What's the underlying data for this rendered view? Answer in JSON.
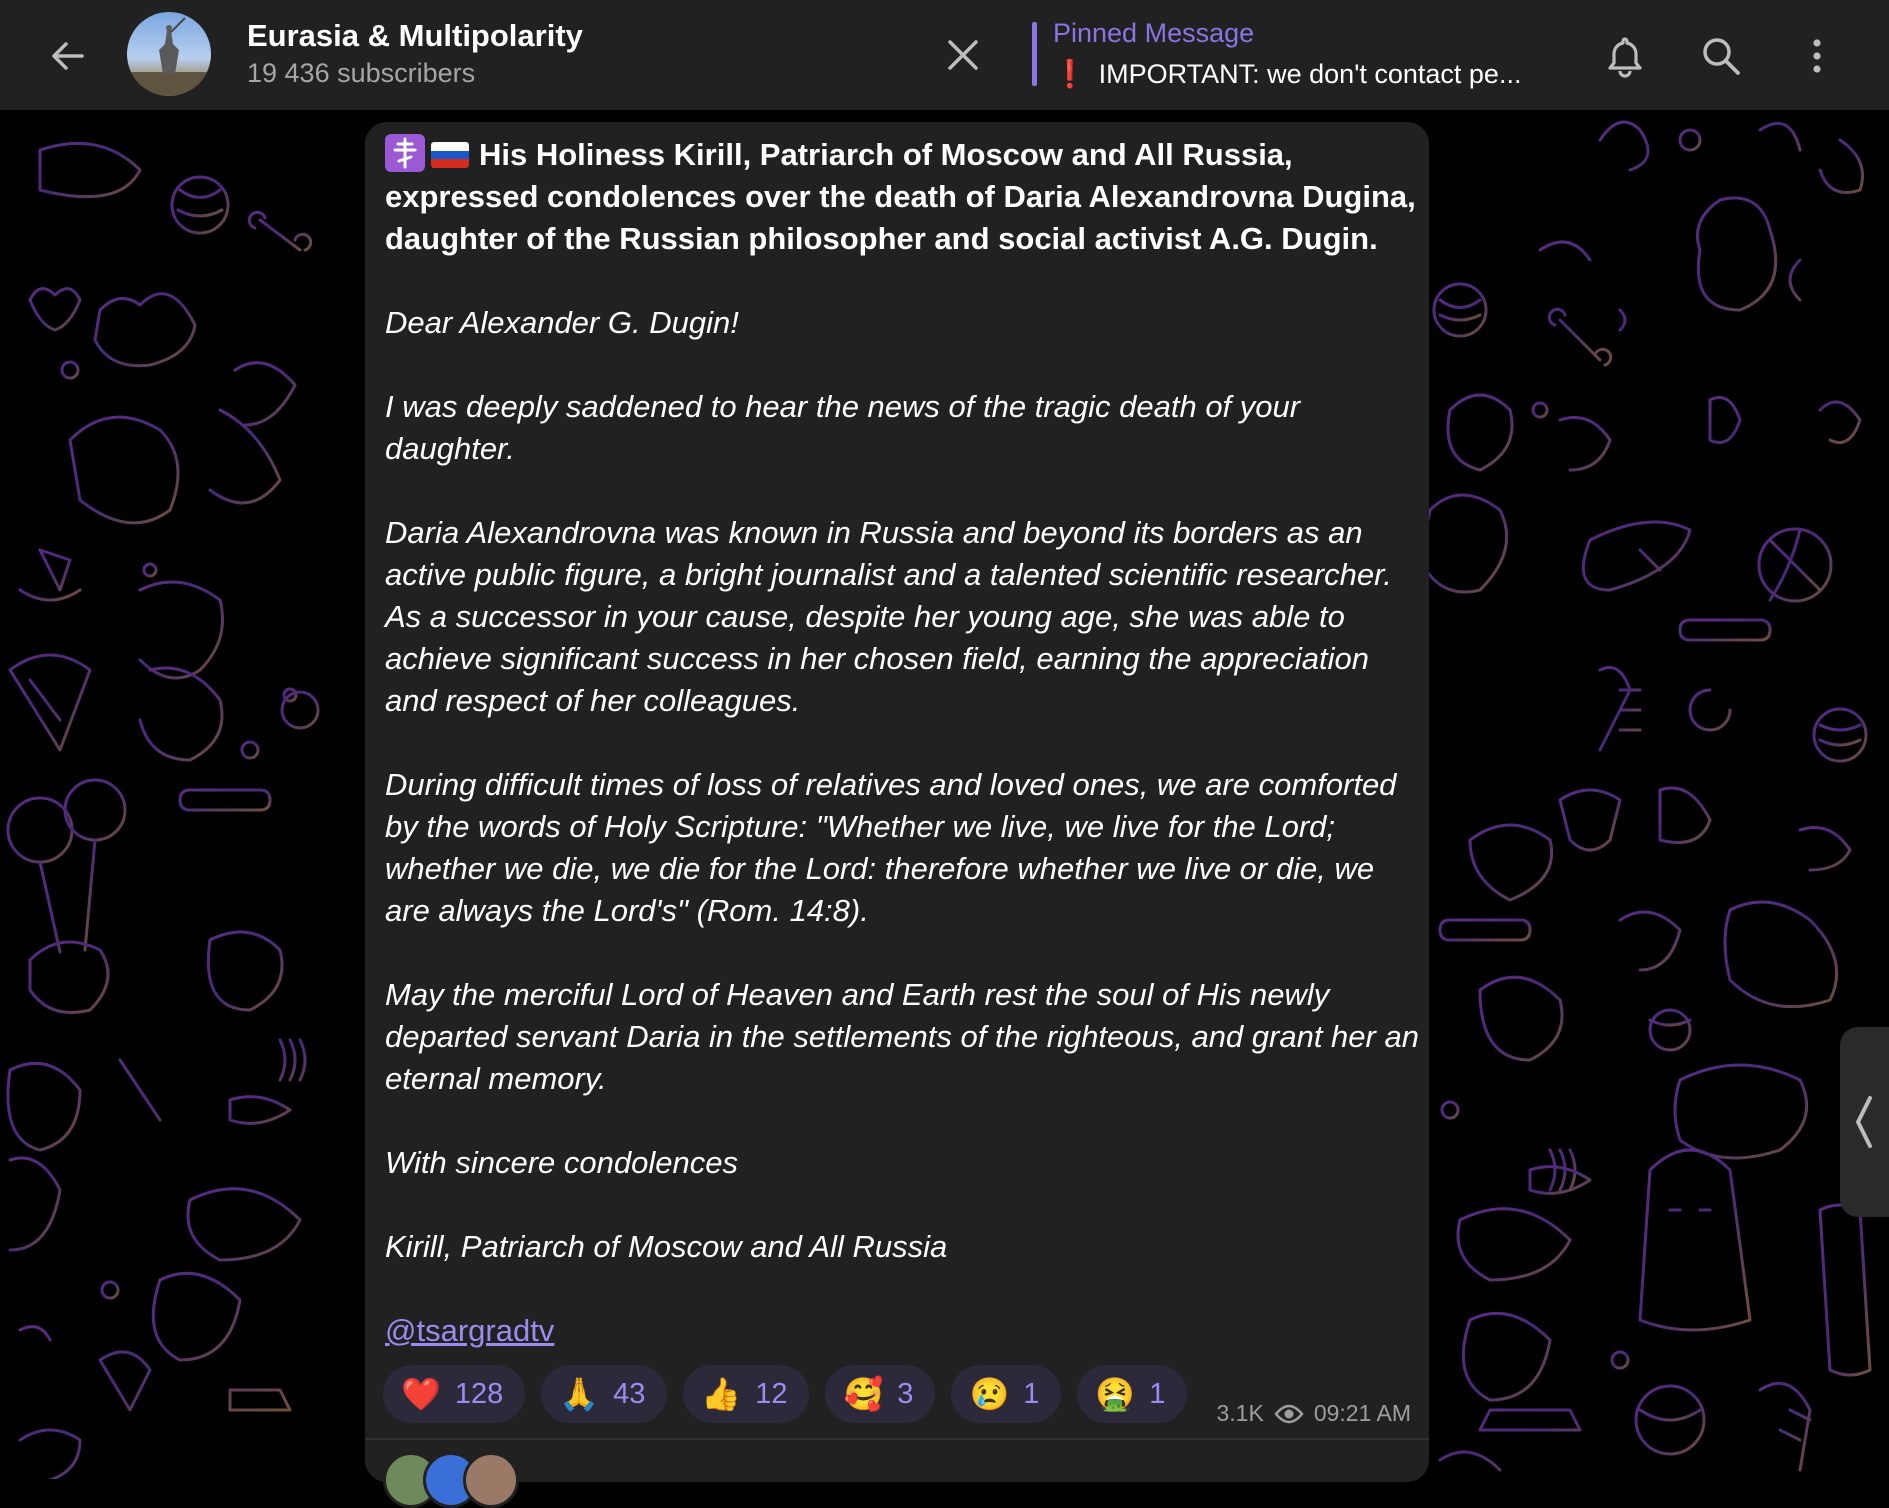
{
  "header": {
    "back_icon": "arrow-left-icon",
    "channel_title": "Eurasia & Multipolarity",
    "subscribers": "19 436 subscribers",
    "close_icon": "close-icon",
    "pinned_label": "Pinned Message",
    "pinned_mark": "❗",
    "pinned_text": "IMPORTANT: we don't contact pe...",
    "actions": [
      "bell-icon",
      "search-icon",
      "more-vertical-icon"
    ]
  },
  "message": {
    "headline": "His Holiness Kirill, Patriarch of Moscow and All Russia, expressed condolences over the death of Daria Alexandrovna Dugina, daughter of the Russian philosopher and social activist A.G. Dugin.",
    "paragraphs": [
      "Dear Alexander G. Dugin!",
      "I was deeply saddened to hear the news of the tragic death of your daughter.",
      "Daria Alexandrovna was known in Russia and beyond its borders as an active public figure, a bright journalist and a talented scientific researcher. As a successor in your cause, despite her young age, she was able to achieve significant success in her chosen field, earning the appreciation and respect of her colleagues.",
      "During difficult times of loss of relatives and loved ones, we are comforted by the words of Holy Scripture: \"Whether we live, we live for the Lord; whether we die, we die for the Lord: therefore whether we live or die, we are always the Lord's\" (Rom. 14:8).",
      "May the merciful Lord of Heaven and Earth rest the soul of His newly departed servant Daria in the settlements of the righteous, and grant her an eternal memory.",
      "With sincere condolences",
      "Kirill, Patriarch of Moscow and All Russia"
    ],
    "mention": "@tsargradtv",
    "reactions": [
      {
        "emoji": "❤️",
        "count": "128"
      },
      {
        "emoji": "🙏",
        "count": "43"
      },
      {
        "emoji": "👍",
        "count": "12"
      },
      {
        "emoji": "🥰",
        "count": "3"
      },
      {
        "emoji": "😢",
        "count": "1"
      },
      {
        "emoji": "🤮",
        "count": "1"
      }
    ],
    "views": "3.1K",
    "time": "09:21 AM"
  },
  "colors": {
    "accent": "#8c74e3",
    "link": "#9c8cf0",
    "bubble": "#212121",
    "topbar": "#212121"
  }
}
